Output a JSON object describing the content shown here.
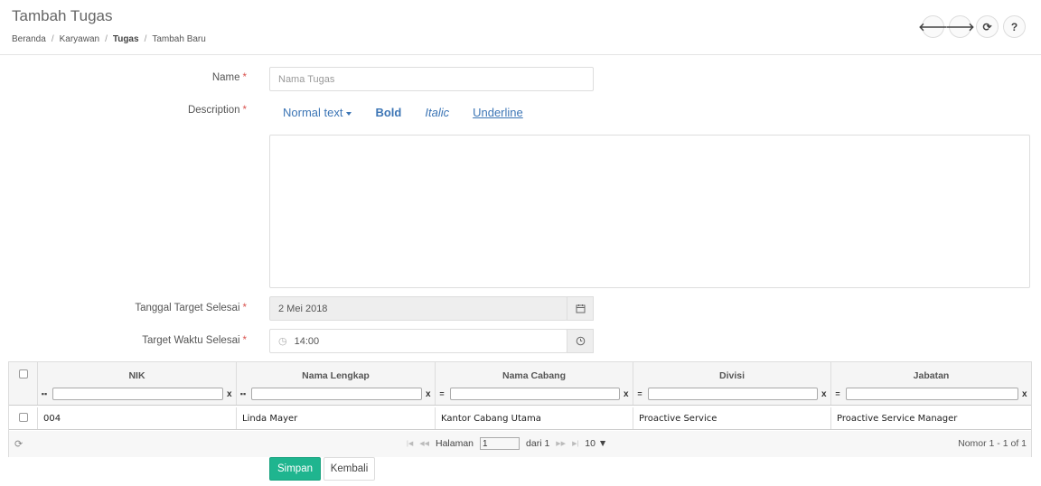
{
  "page": {
    "title": "Tambah Tugas"
  },
  "breadcrumb": {
    "items": [
      "Beranda",
      "Karyawan",
      "Tugas",
      "Tambah Baru"
    ],
    "separator": "/"
  },
  "nav": {
    "buttons": [
      {
        "icon": "arrow-left-icon",
        "glyph": "🡐"
      },
      {
        "icon": "arrow-right-icon",
        "glyph": "🡒"
      },
      {
        "icon": "refresh-icon",
        "glyph": "⟳"
      },
      {
        "icon": "help-icon",
        "glyph": "?"
      }
    ]
  },
  "form": {
    "required_mark": "*",
    "name": {
      "label": "Name",
      "placeholder": "Nama Tugas"
    },
    "description": {
      "label": "Description",
      "toolbar": {
        "normal": "Normal text",
        "bold": "Bold",
        "italic": "Italic",
        "underline": "Underline"
      }
    },
    "target_date": {
      "label": "Tanggal Target Selesai",
      "value": "2 Mei 2018",
      "addon_icon": "calendar-icon"
    },
    "target_time": {
      "label": "Target Waktu Selesai",
      "value": "14:00",
      "addon_icon": "clock-icon"
    }
  },
  "grid": {
    "columns": [
      {
        "title": "NIK",
        "op": "▪▪"
      },
      {
        "title": "Nama Lengkap",
        "op": "▪▪"
      },
      {
        "title": "Nama Cabang",
        "op": "="
      },
      {
        "title": "Divisi",
        "op": "="
      },
      {
        "title": "Jabatan",
        "op": "="
      }
    ],
    "clear_label": "x",
    "rows": [
      {
        "nik": "004",
        "nama": "Linda Mayer",
        "cabang": "Kantor Cabang Utama",
        "divisi": "Proactive Service",
        "jabatan": "Proactive Service Manager"
      }
    ],
    "pager": {
      "page_label": "Halaman",
      "page_value": "1",
      "of_label": "dari 1",
      "page_size": "10",
      "record_info": "Nomor 1 - 1 of 1"
    }
  },
  "actions": {
    "save": "Simpan",
    "back": "Kembali"
  },
  "colors": {
    "accent": "#1fb58f",
    "link": "#3c75b5",
    "required": "#d9534f"
  }
}
